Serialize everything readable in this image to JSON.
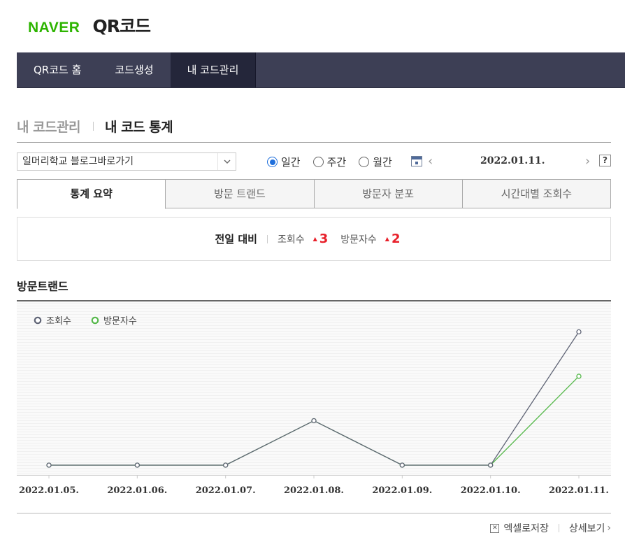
{
  "header": {
    "brand": "NAVER",
    "product": "QR코드"
  },
  "nav": {
    "items": [
      {
        "label": "QR코드 홈"
      },
      {
        "label": "코드생성"
      },
      {
        "label": "내 코드관리"
      }
    ]
  },
  "breadcrumb": {
    "parent": "내 코드관리",
    "current": "내 코드 통계"
  },
  "filter": {
    "selected_code": "일머리학교 블로그바로가기",
    "periods": [
      {
        "label": "일간",
        "checked": true
      },
      {
        "label": "주간",
        "checked": false
      },
      {
        "label": "월간",
        "checked": false
      }
    ],
    "date": "2022.01.11.",
    "help": "?"
  },
  "tabs": [
    {
      "label": "통계 요약",
      "active": true
    },
    {
      "label": "방문 트랜드",
      "active": false
    },
    {
      "label": "방문자 분포",
      "active": false
    },
    {
      "label": "시간대별 조회수",
      "active": false
    }
  ],
  "summary": {
    "label": "전일 대비",
    "views_label": "조회수",
    "views_change": "3",
    "visitors_label": "방문자수",
    "visitors_change": "2"
  },
  "section_title": "방문트랜드",
  "chart_data": {
    "type": "line",
    "categories": [
      "2022.01.05.",
      "2022.01.06.",
      "2022.01.07.",
      "2022.01.08.",
      "2022.01.09.",
      "2022.01.10.",
      "2022.01.11."
    ],
    "series": [
      {
        "name": "조회수",
        "color": "#5f6475",
        "values": [
          0,
          0,
          0,
          1,
          0,
          0,
          3
        ]
      },
      {
        "name": "방문자수",
        "color": "#55b84a",
        "values": [
          0,
          0,
          0,
          1,
          0,
          0,
          2
        ]
      }
    ],
    "ylim": [
      0,
      3.4
    ],
    "legend": "top-left",
    "grid": false
  },
  "footer": {
    "excel": "엑셀로저장",
    "detail": "상세보기"
  }
}
